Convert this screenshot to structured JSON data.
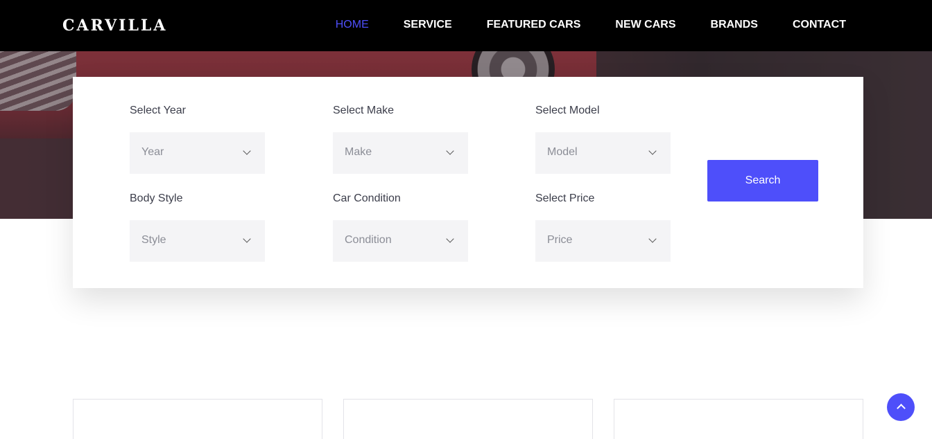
{
  "brand": {
    "logo_text": "CARVILLA"
  },
  "nav": {
    "items": [
      {
        "label": "HOME",
        "active": true
      },
      {
        "label": "SERVICE",
        "active": false
      },
      {
        "label": "FEATURED CARS",
        "active": false
      },
      {
        "label": "NEW CARS",
        "active": false
      },
      {
        "label": "BRANDS",
        "active": false
      },
      {
        "label": "CONTACT",
        "active": false
      }
    ]
  },
  "search": {
    "fields": [
      {
        "label": "Select Year",
        "value": "Year"
      },
      {
        "label": "Select Make",
        "value": "Make"
      },
      {
        "label": "Select Model",
        "value": "Model"
      },
      {
        "label": "Body Style",
        "value": "Style"
      },
      {
        "label": "Car Condition",
        "value": "Condition"
      },
      {
        "label": "Select Price",
        "value": "Price"
      }
    ],
    "button_label": "Search"
  },
  "colors": {
    "accent": "#4e4ffa",
    "navbar": "#000000",
    "select_bg": "#f4f4f6"
  },
  "icons": {
    "select_chevron": "chevron-down-icon",
    "back_to_top": "chevron-up-icon"
  }
}
